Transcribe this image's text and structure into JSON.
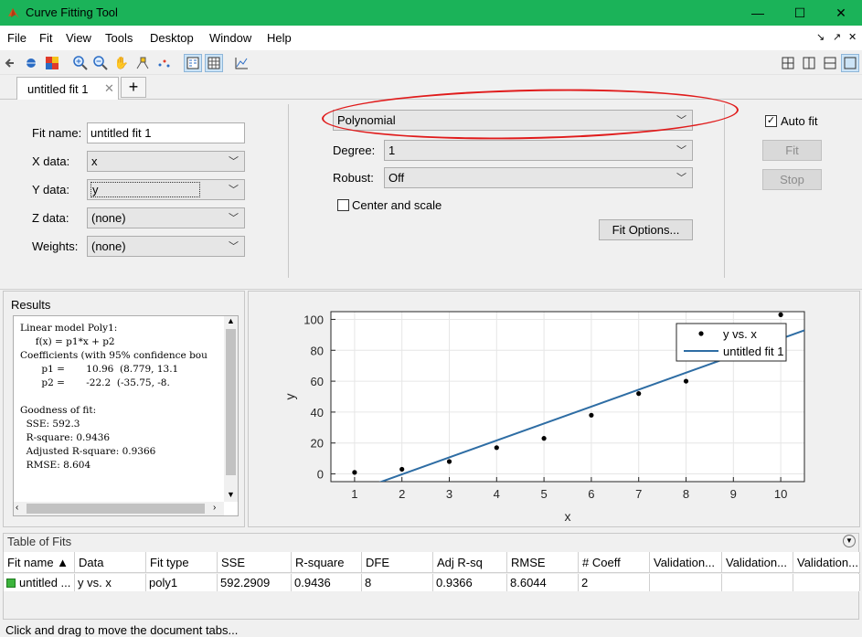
{
  "window": {
    "title": "Curve Fitting Tool",
    "min": "—",
    "max": "☐",
    "close": "✕"
  },
  "menu": {
    "items": [
      "File",
      "Fit",
      "View",
      "Tools",
      "Desktop",
      "Window",
      "Help"
    ],
    "right": [
      "↘",
      "↗",
      "✕"
    ]
  },
  "tabs": {
    "active": "untitled fit 1",
    "close": "✕",
    "add": "+"
  },
  "setup": {
    "fit_name_label": "Fit name:",
    "fit_name_value": "untitled fit 1",
    "x_label": "X data:",
    "x_value": "x",
    "y_label": "Y data:",
    "y_value": "y",
    "z_label": "Z data:",
    "z_value": "(none)",
    "w_label": "Weights:",
    "w_value": "(none)",
    "fit_type": "Polynomial",
    "degree_label": "Degree:",
    "degree_value": "1",
    "robust_label": "Robust:",
    "robust_value": "Off",
    "center_scale_label": "Center and scale",
    "fit_options_label": "Fit Options...",
    "auto_fit_label": "Auto fit",
    "fit_button": "Fit",
    "stop_button": "Stop"
  },
  "results": {
    "title": "Results",
    "lines": [
      "Linear model Poly1:",
      "     f(x) = p1*x + p2",
      "Coefficients (with 95% confidence bou",
      "       p1 =       10.96  (8.779, 13.1",
      "       p2 =       -22.2  (-35.75, -8.",
      "",
      "Goodness of fit:",
      "  SSE: 592.3",
      "  R-square: 0.9436",
      "  Adjusted R-square: 0.9366",
      "  RMSE: 8.604"
    ]
  },
  "chart_data": {
    "type": "scatter",
    "xlabel": "x",
    "ylabel": "y",
    "xlim": [
      0.5,
      10.5
    ],
    "ylim": [
      -5,
      105
    ],
    "xticks": [
      1,
      2,
      3,
      4,
      5,
      6,
      7,
      8,
      9,
      10
    ],
    "yticks": [
      0,
      20,
      40,
      60,
      80,
      100
    ],
    "grid": true,
    "legend_position": "top-right",
    "series": [
      {
        "name": "y vs. x",
        "kind": "points",
        "x": [
          1,
          2,
          3,
          4,
          5,
          6,
          7,
          8,
          9,
          10
        ],
        "y": [
          1,
          3,
          8,
          17,
          23,
          38,
          52,
          60,
          80,
          103
        ]
      },
      {
        "name": "untitled fit 1",
        "kind": "line",
        "slope": 10.96,
        "intercept": -22.2
      }
    ],
    "colors": {
      "points": "#000000",
      "line": "#2e6da4"
    }
  },
  "table_of_fits": {
    "title": "Table of Fits",
    "columns": [
      "Fit name ▲",
      "Data",
      "Fit type",
      "SSE",
      "R-square",
      "DFE",
      "Adj R-sq",
      "RMSE",
      "# Coeff",
      "Validation...",
      "Validation...",
      "Validation..."
    ],
    "rows": [
      [
        "untitled ...",
        "y vs. x",
        "poly1",
        "592.2909",
        "0.9436",
        "8",
        "0.9366",
        "8.6044",
        "2",
        "",
        "",
        ""
      ]
    ]
  },
  "status": "Click and drag to move the document tabs...",
  "colors": {
    "titlebar": "#1bb359",
    "annotation": "#e01b1b",
    "fit_line": "#2e6da4"
  }
}
